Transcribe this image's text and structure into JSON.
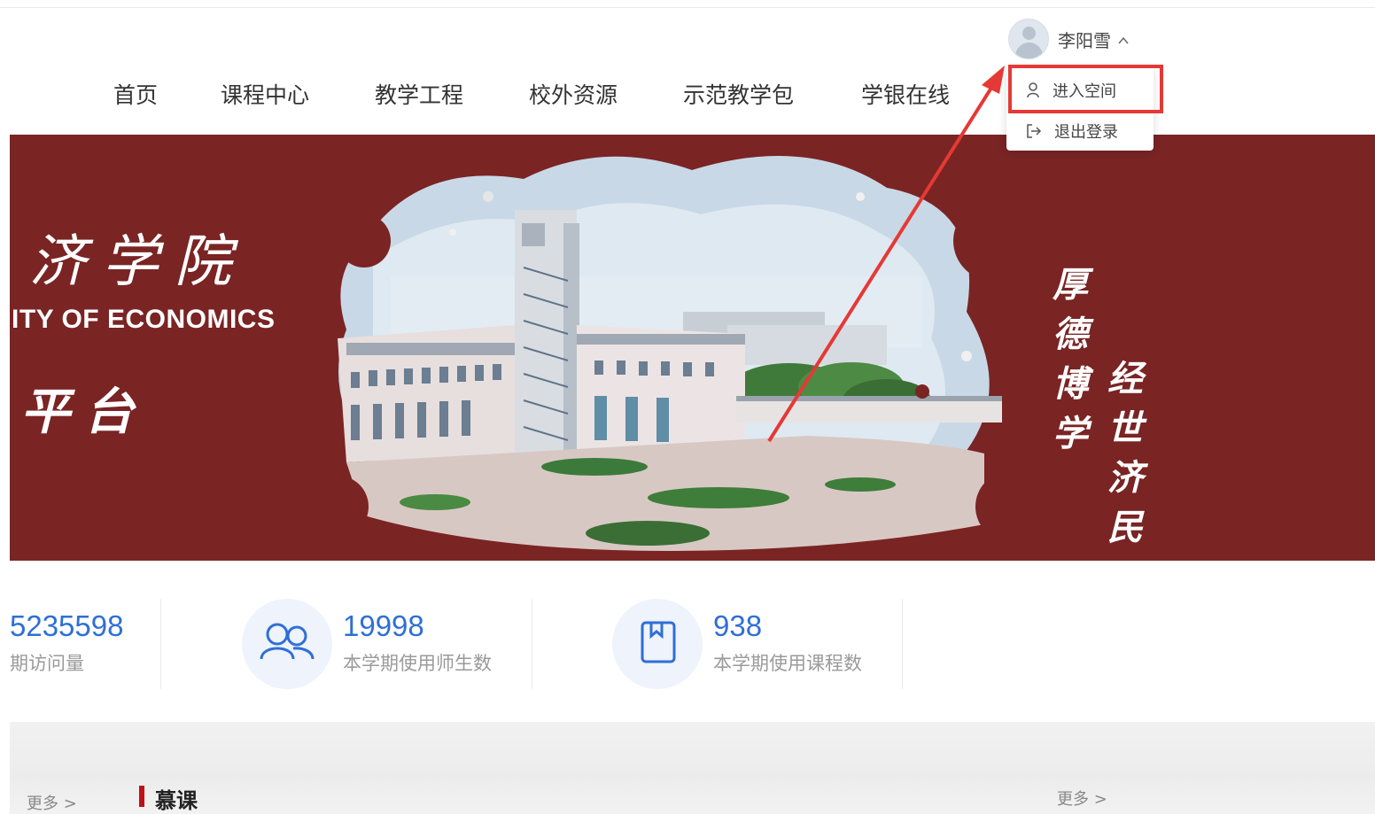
{
  "user": {
    "name": "李阳雪",
    "menu": {
      "enter_space": "进入空间",
      "logout": "退出登录"
    }
  },
  "nav": {
    "items": [
      {
        "label": "首页"
      },
      {
        "label": "课程中心"
      },
      {
        "label": "教学工程"
      },
      {
        "label": "校外资源"
      },
      {
        "label": "示范教学包"
      },
      {
        "label": "学银在线"
      }
    ]
  },
  "banner": {
    "title_partial": "济学院",
    "subtitle_en_partial": "ITY OF ECONOMICS",
    "subtitle_cn_partial": "平台",
    "motto_col1": "厚德博学",
    "motto_col2": "经世济民"
  },
  "stats": [
    {
      "value": "5235598",
      "label": "期访问量",
      "icon": "none"
    },
    {
      "value": "19998",
      "label": "本学期使用师生数",
      "icon": "users-icon"
    },
    {
      "value": "938",
      "label": "本学期使用课程数",
      "icon": "book-icon"
    }
  ],
  "section": {
    "title": "慕课",
    "more_left": "更多 >",
    "more_right": "更多 >"
  },
  "colors": {
    "banner_bg": "#7a2424",
    "accent_blue": "#2f6fd6",
    "highlight_red": "#e53935",
    "section_bar": "#c0111a"
  }
}
